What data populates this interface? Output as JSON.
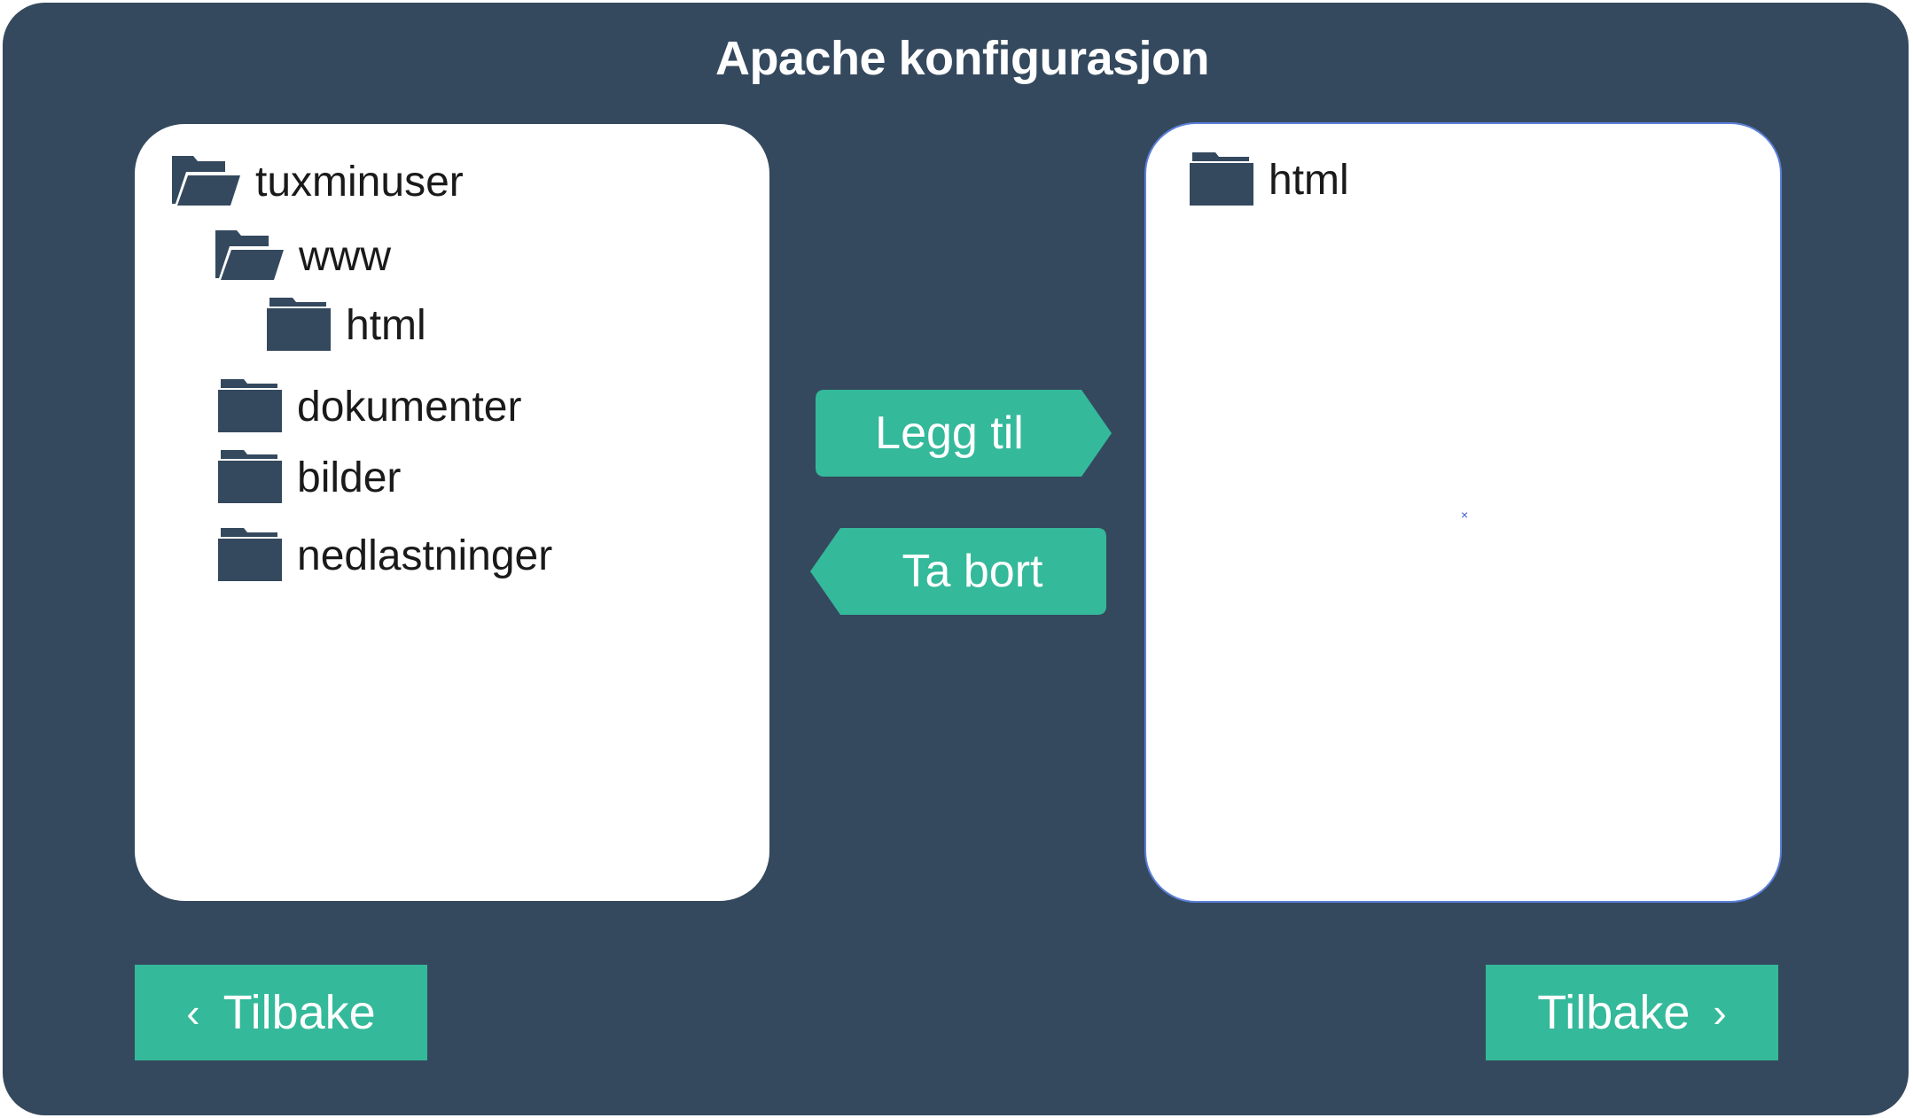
{
  "window": {
    "title": "Apache konfigurasjon"
  },
  "left_panel": {
    "items": [
      {
        "label": "tuxminuser",
        "icon": "folder-open-icon"
      },
      {
        "label": "www",
        "icon": "folder-open-icon"
      },
      {
        "label": "html",
        "icon": "folder-icon"
      },
      {
        "label": "dokumenter",
        "icon": "folder-icon"
      },
      {
        "label": "bilder",
        "icon": "folder-icon"
      },
      {
        "label": "nedlastninger",
        "icon": "folder-icon"
      }
    ]
  },
  "right_panel": {
    "items": [
      {
        "label": "html",
        "icon": "folder-icon"
      }
    ],
    "marker": "×"
  },
  "actions": {
    "add_label": "Legg til",
    "remove_label": "Ta bort"
  },
  "nav": {
    "back_label": "Tilbake",
    "back_chevron": "‹",
    "next_label": "Tilbake",
    "next_chevron": "›"
  },
  "colors": {
    "background": "#34495e",
    "accent": "#34b99a",
    "panel": "#ffffff",
    "selection_outline": "#5b7fd9"
  }
}
